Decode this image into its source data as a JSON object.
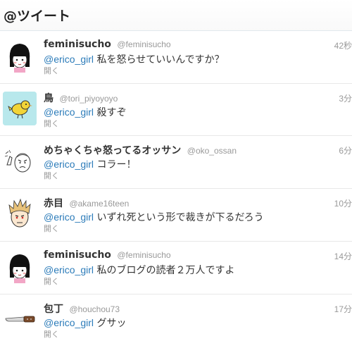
{
  "header": {
    "title": "@ツイート"
  },
  "tweets": [
    {
      "name": "feminisucho",
      "handle": "@feminisucho",
      "time": "42秒",
      "mention": "@erico_girl",
      "text": "私を怒らせていいんですか？",
      "open": "開く",
      "avatar": "girl-avatar"
    },
    {
      "name": "鳥",
      "handle": "@tori_piyoyoyo",
      "time": "3分",
      "mention": "@erico_girl",
      "text": "殺すぞ",
      "open": "開く",
      "avatar": "bird-avatar",
      "avatar_bg": "#b8e8ec"
    },
    {
      "name": "めちゃくちゃ怒ってるオッサン",
      "handle": "@oko_ossan",
      "time": "6分",
      "mention": "@erico_girl",
      "text": "コラー！",
      "open": "開く",
      "avatar": "angry-man-avatar"
    },
    {
      "name": "赤目",
      "handle": "@akame16teen",
      "time": "10分",
      "mention": "@erico_girl",
      "text": "いずれ死という形で裁きが下るだろう",
      "open": "開く",
      "avatar": "spiky-hair-avatar"
    },
    {
      "name": "feminisucho",
      "handle": "@feminisucho",
      "time": "14分",
      "mention": "@erico_girl",
      "text": "私のブログの読者２万人ですよ",
      "open": "開く",
      "avatar": "girl-avatar"
    },
    {
      "name": "包丁",
      "handle": "@houchou73",
      "time": "17分",
      "mention": "@erico_girl",
      "text": "グサッ",
      "open": "開く",
      "avatar": "knife-avatar"
    }
  ]
}
